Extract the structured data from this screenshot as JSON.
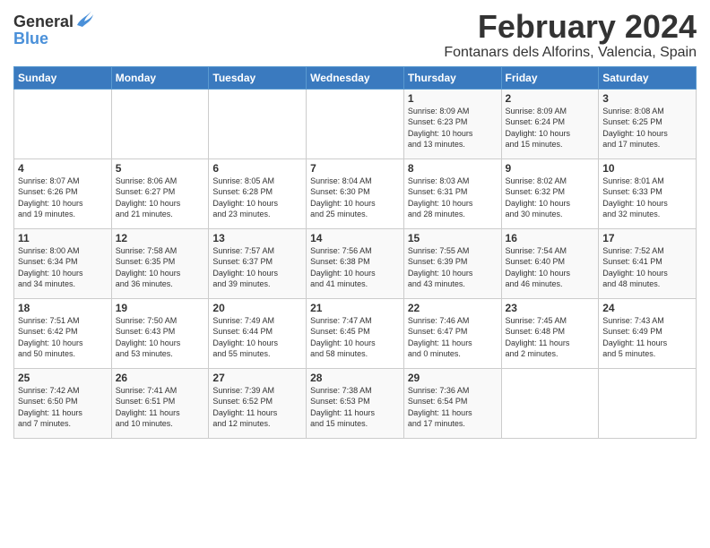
{
  "header": {
    "logo_general": "General",
    "logo_blue": "Blue",
    "month_title": "February 2024",
    "location": "Fontanars dels Alforins, Valencia, Spain"
  },
  "weekdays": [
    "Sunday",
    "Monday",
    "Tuesday",
    "Wednesday",
    "Thursday",
    "Friday",
    "Saturday"
  ],
  "weeks": [
    [
      {
        "day": "",
        "detail": ""
      },
      {
        "day": "",
        "detail": ""
      },
      {
        "day": "",
        "detail": ""
      },
      {
        "day": "",
        "detail": ""
      },
      {
        "day": "1",
        "detail": "Sunrise: 8:09 AM\nSunset: 6:23 PM\nDaylight: 10 hours\nand 13 minutes."
      },
      {
        "day": "2",
        "detail": "Sunrise: 8:09 AM\nSunset: 6:24 PM\nDaylight: 10 hours\nand 15 minutes."
      },
      {
        "day": "3",
        "detail": "Sunrise: 8:08 AM\nSunset: 6:25 PM\nDaylight: 10 hours\nand 17 minutes."
      }
    ],
    [
      {
        "day": "4",
        "detail": "Sunrise: 8:07 AM\nSunset: 6:26 PM\nDaylight: 10 hours\nand 19 minutes."
      },
      {
        "day": "5",
        "detail": "Sunrise: 8:06 AM\nSunset: 6:27 PM\nDaylight: 10 hours\nand 21 minutes."
      },
      {
        "day": "6",
        "detail": "Sunrise: 8:05 AM\nSunset: 6:28 PM\nDaylight: 10 hours\nand 23 minutes."
      },
      {
        "day": "7",
        "detail": "Sunrise: 8:04 AM\nSunset: 6:30 PM\nDaylight: 10 hours\nand 25 minutes."
      },
      {
        "day": "8",
        "detail": "Sunrise: 8:03 AM\nSunset: 6:31 PM\nDaylight: 10 hours\nand 28 minutes."
      },
      {
        "day": "9",
        "detail": "Sunrise: 8:02 AM\nSunset: 6:32 PM\nDaylight: 10 hours\nand 30 minutes."
      },
      {
        "day": "10",
        "detail": "Sunrise: 8:01 AM\nSunset: 6:33 PM\nDaylight: 10 hours\nand 32 minutes."
      }
    ],
    [
      {
        "day": "11",
        "detail": "Sunrise: 8:00 AM\nSunset: 6:34 PM\nDaylight: 10 hours\nand 34 minutes."
      },
      {
        "day": "12",
        "detail": "Sunrise: 7:58 AM\nSunset: 6:35 PM\nDaylight: 10 hours\nand 36 minutes."
      },
      {
        "day": "13",
        "detail": "Sunrise: 7:57 AM\nSunset: 6:37 PM\nDaylight: 10 hours\nand 39 minutes."
      },
      {
        "day": "14",
        "detail": "Sunrise: 7:56 AM\nSunset: 6:38 PM\nDaylight: 10 hours\nand 41 minutes."
      },
      {
        "day": "15",
        "detail": "Sunrise: 7:55 AM\nSunset: 6:39 PM\nDaylight: 10 hours\nand 43 minutes."
      },
      {
        "day": "16",
        "detail": "Sunrise: 7:54 AM\nSunset: 6:40 PM\nDaylight: 10 hours\nand 46 minutes."
      },
      {
        "day": "17",
        "detail": "Sunrise: 7:52 AM\nSunset: 6:41 PM\nDaylight: 10 hours\nand 48 minutes."
      }
    ],
    [
      {
        "day": "18",
        "detail": "Sunrise: 7:51 AM\nSunset: 6:42 PM\nDaylight: 10 hours\nand 50 minutes."
      },
      {
        "day": "19",
        "detail": "Sunrise: 7:50 AM\nSunset: 6:43 PM\nDaylight: 10 hours\nand 53 minutes."
      },
      {
        "day": "20",
        "detail": "Sunrise: 7:49 AM\nSunset: 6:44 PM\nDaylight: 10 hours\nand 55 minutes."
      },
      {
        "day": "21",
        "detail": "Sunrise: 7:47 AM\nSunset: 6:45 PM\nDaylight: 10 hours\nand 58 minutes."
      },
      {
        "day": "22",
        "detail": "Sunrise: 7:46 AM\nSunset: 6:47 PM\nDaylight: 11 hours\nand 0 minutes."
      },
      {
        "day": "23",
        "detail": "Sunrise: 7:45 AM\nSunset: 6:48 PM\nDaylight: 11 hours\nand 2 minutes."
      },
      {
        "day": "24",
        "detail": "Sunrise: 7:43 AM\nSunset: 6:49 PM\nDaylight: 11 hours\nand 5 minutes."
      }
    ],
    [
      {
        "day": "25",
        "detail": "Sunrise: 7:42 AM\nSunset: 6:50 PM\nDaylight: 11 hours\nand 7 minutes."
      },
      {
        "day": "26",
        "detail": "Sunrise: 7:41 AM\nSunset: 6:51 PM\nDaylight: 11 hours\nand 10 minutes."
      },
      {
        "day": "27",
        "detail": "Sunrise: 7:39 AM\nSunset: 6:52 PM\nDaylight: 11 hours\nand 12 minutes."
      },
      {
        "day": "28",
        "detail": "Sunrise: 7:38 AM\nSunset: 6:53 PM\nDaylight: 11 hours\nand 15 minutes."
      },
      {
        "day": "29",
        "detail": "Sunrise: 7:36 AM\nSunset: 6:54 PM\nDaylight: 11 hours\nand 17 minutes."
      },
      {
        "day": "",
        "detail": ""
      },
      {
        "day": "",
        "detail": ""
      }
    ]
  ]
}
